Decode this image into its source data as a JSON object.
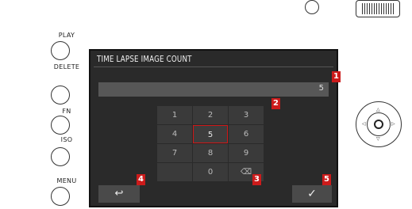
{
  "side_buttons": [
    {
      "label": "PLAY"
    },
    {
      "label": "DELETE"
    },
    {
      "label": "FN"
    },
    {
      "label": "ISO"
    },
    {
      "label": "MENU"
    }
  ],
  "screen": {
    "title": "TIME LAPSE IMAGE COUNT",
    "input_value": "5",
    "keypad": [
      [
        "1",
        "2",
        "3"
      ],
      [
        "4",
        "5",
        "6"
      ],
      [
        "7",
        "8",
        "9"
      ],
      [
        "",
        "0",
        "⌫"
      ]
    ],
    "selected_key": "5",
    "back_label": "↩",
    "ok_label": "✓"
  },
  "callouts": [
    "1",
    "2",
    "3",
    "4",
    "5"
  ],
  "colors": {
    "callout": "#cc1b1b",
    "screen_bg": "#2a2a2a",
    "selection": "#d01818"
  }
}
